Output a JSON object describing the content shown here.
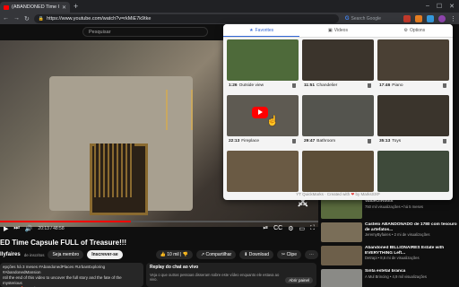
{
  "browser": {
    "tab_title": "(ABANDONED Time Ca",
    "url": "https://www.youtube.com/watch?v=rkMiE7k9tke",
    "google_placeholder": "Search Google"
  },
  "youtube": {
    "search_placeholder": "Pesquisar",
    "player": {
      "time": "20:13 / 48:58",
      "progress": 0.41
    },
    "title": "ED Time Capsule FULL of Treasure!!!",
    "channel": "llyfaires",
    "subs": "de inscritos",
    "join_label": "Seja membro",
    "subscribe_label": "Inscrever-se",
    "likes": "10 mil",
    "share_label": "Compartilhar",
    "download_label": "Download",
    "clip_label": "Clipe",
    "description": "epções há 3 meses #AbandonedPlaces #UrbanExploring #AbandonedMansion\nntil the end of this video to uncover the full story and the fate of the mysterious\ne owner! 🔥 ...mais",
    "livechat": {
      "title": "Replay do chat ao vivo",
      "body": "Veja o que outras pessoas disseram sobre este vídeo enquanto ele estava ao vivo.",
      "button": "Abrir painel"
    },
    "recs": [
      {
        "title": "ValueOfRoots",
        "meta": "750 mil visualizações • há 5 meses",
        "color": "#5a6b3e"
      },
      {
        "title": "Castelo ABANDONADO de 1780 com tesouro de artefatos...",
        "meta": "JeremyByfaires • 2 mi de visualizações",
        "color": "#7a6e58"
      },
      {
        "title": "Abandoned BILLIONAIRES Estate with EVERYTHING Left...",
        "meta": "Detrapi • 8,6 mi de visualizações",
        "color": "#6d5f4a"
      },
      {
        "title": "Sinta estetal branca",
        "meta": "A Mul Brincing • 4,9 mil visualizações",
        "color": "#8a8a86"
      }
    ]
  },
  "popup": {
    "tabs": [
      {
        "label": "Favorites",
        "icon": "star-icon"
      },
      {
        "label": "Videos",
        "icon": "video-icon"
      },
      {
        "label": "Options",
        "icon": "gear-icon"
      }
    ],
    "cards": [
      {
        "time": "1:26",
        "label": "Outside view",
        "color": "#4e6a3a"
      },
      {
        "time": "11:51",
        "label": "Chandelier",
        "color": "#3b342c"
      },
      {
        "time": "17:46",
        "label": "Piano",
        "color": "#4a4034"
      },
      {
        "time": "22:13",
        "label": "Fireplace",
        "color": "#5e5a52"
      },
      {
        "time": "29:47",
        "label": "Bathroom",
        "color": "#54544e"
      },
      {
        "time": "35:13",
        "label": "Toys",
        "color": "#3a342c"
      },
      {
        "time": "",
        "label": "",
        "color": "#6a5a44"
      },
      {
        "time": "",
        "label": "",
        "color": "#5c4e38"
      },
      {
        "time": "",
        "label": "",
        "color": "#3e4a3a"
      }
    ],
    "footer_pre": "YT QuickMarks · Created with",
    "footer_post": "by MarksSXP"
  }
}
